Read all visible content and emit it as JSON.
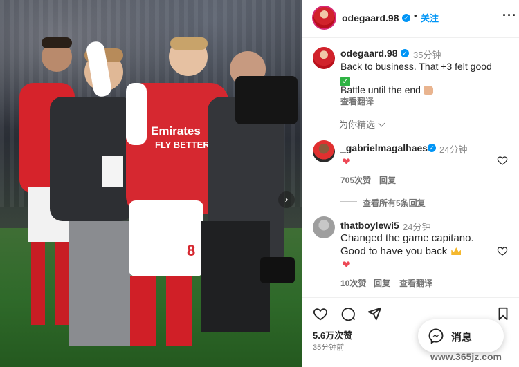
{
  "post": {
    "author": "odegaard.98",
    "follow_label": "关注",
    "dot": "•",
    "more_label": "···",
    "caption_time": "35分钟",
    "caption_line1": "Back to business. That +3 felt good",
    "caption_line2": "Battle until the end",
    "see_translation": "查看翻译"
  },
  "sort": {
    "label": "为你精选"
  },
  "comments": [
    {
      "user": "_gabrielmagalhaes",
      "time": "24分钟",
      "likes": "705次赞",
      "reply": "回复",
      "view_replies": "查看所有5条回复"
    },
    {
      "user": "thatboylewi5",
      "time": "24分钟",
      "text_line1": "Changed the game capitano.",
      "text_line2": "Good to have you back",
      "likes": "10次赞",
      "reply": "回复",
      "see_translation": "查看翻译"
    }
  ],
  "footer": {
    "likes": "5.6万次赞",
    "time": "35分钟前",
    "message_label": "消息"
  },
  "watermark": "www.365jz.com",
  "icons": {
    "verified": "verified-badge-icon",
    "heart": "heart-icon",
    "comment": "comment-icon",
    "share": "share-icon",
    "save": "bookmark-icon",
    "messenger": "messenger-icon",
    "next": "chevron-right-icon"
  },
  "colors": {
    "accent": "#0095f6",
    "like": "#ed4956",
    "arsenal_red": "#d1222b"
  }
}
